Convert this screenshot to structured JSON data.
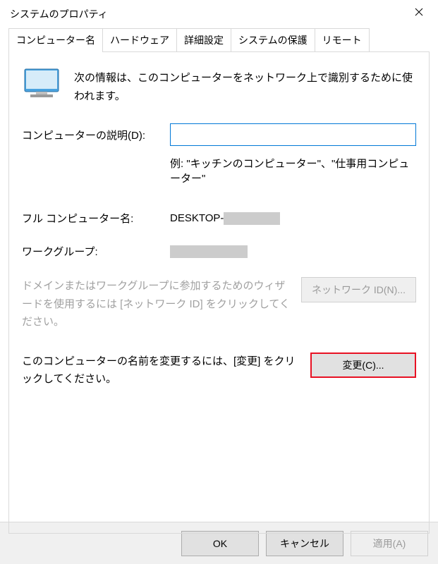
{
  "window": {
    "title": "システムのプロパティ"
  },
  "tabs": {
    "computer_name": "コンピューター名",
    "hardware": "ハードウェア",
    "advanced": "詳細設定",
    "system_protection": "システムの保護",
    "remote": "リモート"
  },
  "panel": {
    "info": "次の情報は、このコンピューターをネットワーク上で識別するために使われます。",
    "description_label": "コンピューターの説明(D):",
    "description_value": "",
    "example": "例: \"キッチンのコンピューター\"、\"仕事用コンピューター\"",
    "full_name_label": "フル コンピューター名:",
    "full_name_prefix": "DESKTOP-",
    "workgroup_label": "ワークグループ:",
    "network_id_text": "ドメインまたはワークグループに参加するためのウィザードを使用するには [ネットワーク ID] をクリックしてください。",
    "network_id_button": "ネットワーク ID(N)...",
    "change_text": "このコンピューターの名前を変更するには、[変更] をクリックしてください。",
    "change_button": "変更(C)..."
  },
  "footer": {
    "ok": "OK",
    "cancel": "キャンセル",
    "apply": "適用(A)"
  }
}
